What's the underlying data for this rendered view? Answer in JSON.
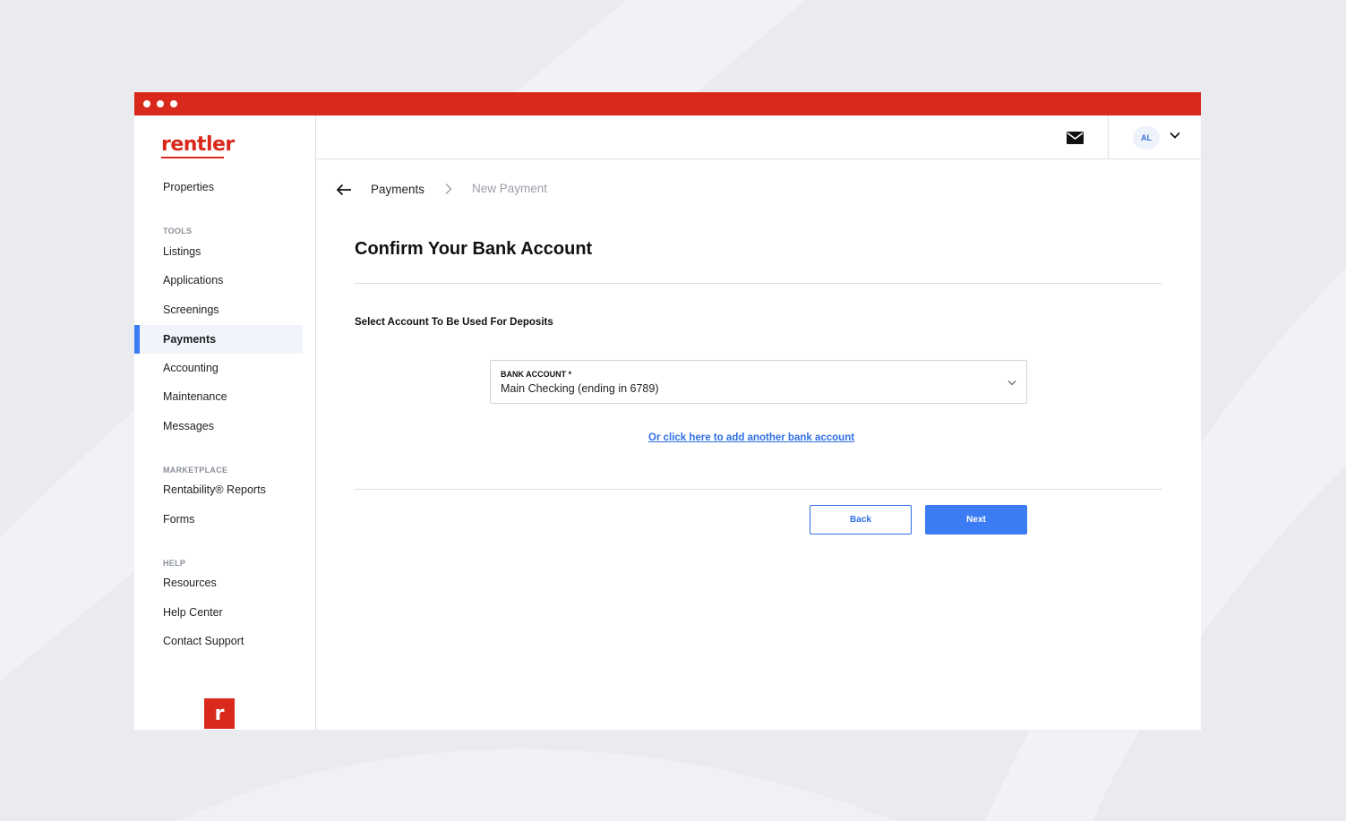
{
  "colors": {
    "brand": "#d9291c",
    "accent": "#3b7cf5",
    "link": "#2f6fe4"
  },
  "sidebar": {
    "logo": "rentler",
    "items_top": [
      {
        "label": "Properties",
        "icon": "none"
      }
    ],
    "sections": [
      {
        "title": "TOOLS",
        "items": [
          {
            "label": "Listings"
          },
          {
            "label": "Applications"
          },
          {
            "label": "Screenings"
          },
          {
            "label": "Payments",
            "active": true
          },
          {
            "label": "Accounting"
          },
          {
            "label": "Maintenance"
          },
          {
            "label": "Messages"
          }
        ]
      },
      {
        "title": "MARKETPLACE",
        "items": [
          {
            "label": "Rentability® Reports"
          },
          {
            "label": "Forms"
          }
        ]
      },
      {
        "title": "HELP",
        "items": [
          {
            "label": "Resources"
          },
          {
            "label": "Help Center"
          },
          {
            "label": "Contact Support"
          }
        ]
      }
    ],
    "badge": "r"
  },
  "topbar": {
    "mail_icon": "mail-icon",
    "avatar_initials": "AL",
    "menu_icon": "chevron-down-icon"
  },
  "breadcrumb": {
    "parent": "Payments",
    "current": "New Payment"
  },
  "page": {
    "title": "Confirm Your Bank Account",
    "section_label": "Select Account To Be Used For Deposits",
    "select": {
      "label": "BANK ACCOUNT *",
      "value": "Main Checking (ending in 6789)"
    },
    "add_link": "Or click here to add another bank account",
    "back_button": "Back",
    "next_button": "Next"
  }
}
